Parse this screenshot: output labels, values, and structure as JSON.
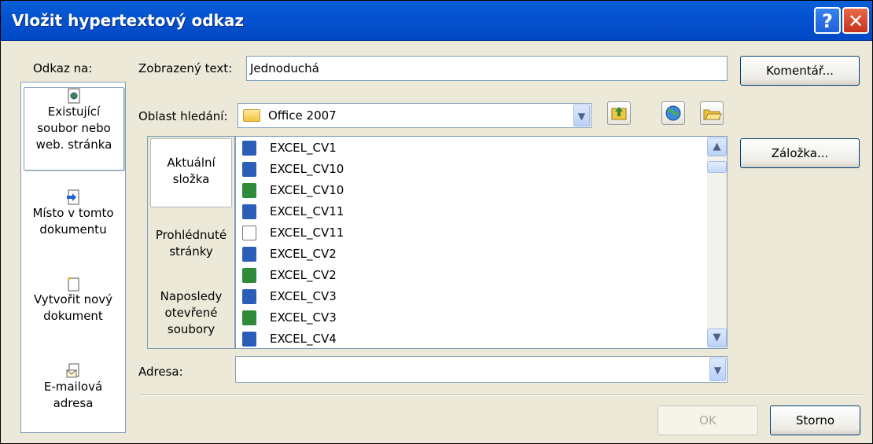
{
  "title": "Vložit hypertextový odkaz",
  "title_buttons": {
    "help": "?",
    "close": "✕"
  },
  "link_to": {
    "label": "Odkaz na:",
    "items": [
      {
        "lines": [
          "Existující",
          "soubor nebo",
          "web. stránka"
        ],
        "icon": "existing-file-icon",
        "selected": true
      },
      {
        "lines": [
          "Místo v tomto",
          "dokumentu"
        ],
        "icon": "place-in-document-icon",
        "selected": false
      },
      {
        "lines": [
          "Vytvořit nový",
          "dokument"
        ],
        "icon": "new-document-icon",
        "selected": false
      },
      {
        "lines": [
          "E-mailová",
          "adresa"
        ],
        "icon": "email-icon",
        "selected": false
      }
    ]
  },
  "display_text": {
    "label": "Zobrazený text:",
    "value": "Jednoduchá"
  },
  "look_in": {
    "label": "Oblast hledání:",
    "value": "Office 2007"
  },
  "toolbar_icons": [
    "up-folder-icon",
    "browse-web-icon",
    "browse-file-icon"
  ],
  "nav": {
    "items": [
      {
        "lines": [
          "Aktuální",
          "složka"
        ],
        "selected": true
      },
      {
        "lines": [
          "Prohlédnuté",
          "stránky"
        ],
        "selected": false
      },
      {
        "lines": [
          "Naposledy",
          "otevřené",
          "soubory"
        ],
        "selected": false
      }
    ]
  },
  "files": [
    {
      "name": "EXCEL_CV1",
      "type": "word"
    },
    {
      "name": "EXCEL_CV10",
      "type": "word"
    },
    {
      "name": "EXCEL_CV10",
      "type": "excel"
    },
    {
      "name": "EXCEL_CV11",
      "type": "word"
    },
    {
      "name": "EXCEL_CV11",
      "type": "text"
    },
    {
      "name": "EXCEL_CV2",
      "type": "word"
    },
    {
      "name": "EXCEL_CV2",
      "type": "excel"
    },
    {
      "name": "EXCEL_CV3",
      "type": "word"
    },
    {
      "name": "EXCEL_CV3",
      "type": "excel"
    },
    {
      "name": "EXCEL_CV4",
      "type": "word"
    }
  ],
  "address": {
    "label": "Adresa:",
    "value": ""
  },
  "buttons": {
    "comment": "Komentář...",
    "bookmark": "Záložka...",
    "ok": "OK",
    "cancel": "Storno"
  },
  "colors": {
    "titlebar": "#0453d1",
    "word_icon": "#2b5eb8",
    "excel_icon": "#2e8b3a",
    "face": "#ece9d8"
  }
}
